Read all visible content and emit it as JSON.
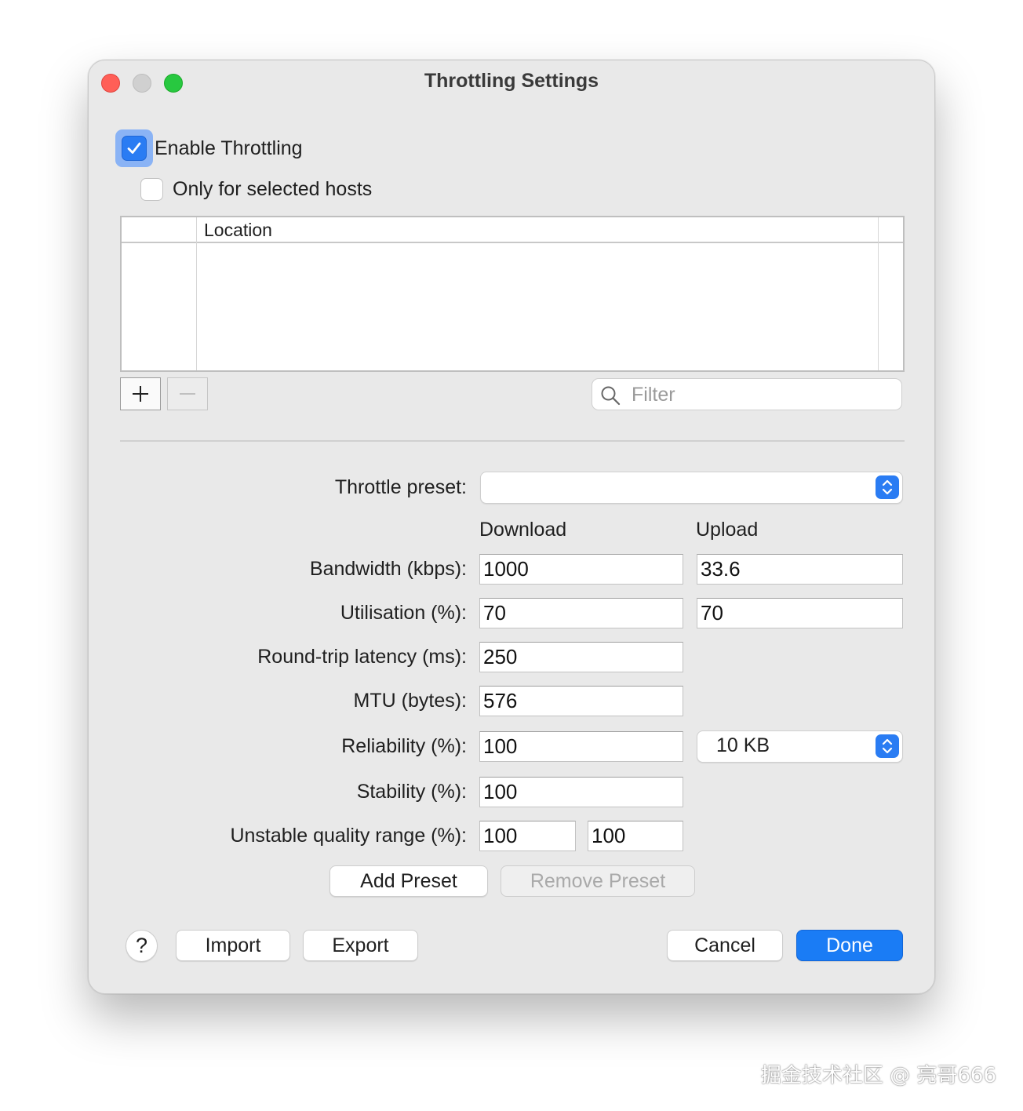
{
  "window": {
    "title": "Throttling Settings"
  },
  "enable_throttling": {
    "label": "Enable Throttling",
    "checked": true
  },
  "only_selected_hosts": {
    "label": "Only for selected hosts",
    "checked": false
  },
  "hosts_table": {
    "columns": [
      "Location"
    ],
    "rows": []
  },
  "filter": {
    "placeholder": "Filter",
    "value": ""
  },
  "preset": {
    "label": "Throttle preset:",
    "value": ""
  },
  "columns": {
    "download": "Download",
    "upload": "Upload"
  },
  "fields": {
    "bandwidth": {
      "label": "Bandwidth (kbps):",
      "download": "1000",
      "upload": "33.6"
    },
    "utilisation": {
      "label": "Utilisation (%):",
      "download": "70",
      "upload": "70"
    },
    "latency": {
      "label": "Round-trip latency (ms):",
      "value": "250"
    },
    "mtu": {
      "label": "MTU (bytes):",
      "value": "576"
    },
    "reliability": {
      "label": "Reliability (%):",
      "value": "100",
      "size_option": "10 KB"
    },
    "stability": {
      "label": "Stability (%):",
      "value": "100"
    },
    "unstable_range": {
      "label": "Unstable quality range (%):",
      "min": "100",
      "max": "100"
    }
  },
  "buttons": {
    "add_preset": "Add Preset",
    "remove_preset": "Remove Preset",
    "help": "?",
    "import": "Import",
    "export": "Export",
    "cancel": "Cancel",
    "done": "Done"
  },
  "watermark": "掘金技术社区 @ 亮哥666",
  "colors": {
    "accent": "#1a7cf5",
    "close": "#ff5f57",
    "zoom": "#28c840"
  }
}
